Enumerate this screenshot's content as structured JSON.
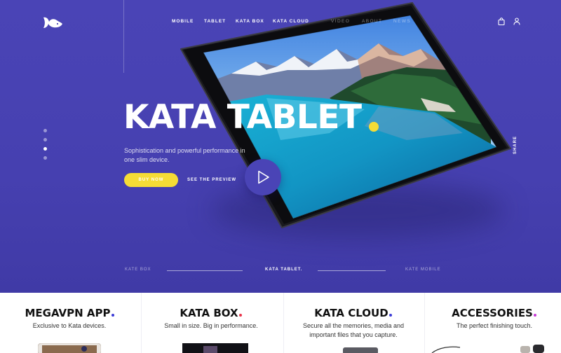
{
  "header": {
    "logo": "fish-logo",
    "nav": [
      {
        "label": "MOBILE",
        "dim": false
      },
      {
        "label": "TABLET",
        "dim": false
      },
      {
        "label": "KATA BOX",
        "dim": false
      },
      {
        "label": "KATA CLOUD",
        "dim": false
      },
      {
        "label": "VIDEO",
        "dim": true
      },
      {
        "label": "ABOUT",
        "dim": true
      },
      {
        "label": "NEWS",
        "dim": true
      }
    ],
    "icons": [
      "bag-icon",
      "user-icon"
    ]
  },
  "hero": {
    "title": "KATA TABLET",
    "subtitle": "Sophistication and powerful performance in one slim device.",
    "buy_label": "BUY NOW",
    "preview_label": "SEE THE PREVIEW",
    "share_label": "SHARE",
    "slide_dots": 4,
    "active_dot": 3,
    "accent_color": "#f5dc36",
    "background_color": "#4a44b6"
  },
  "slider_nav": {
    "prev": "KATE BOX",
    "current": "KATA TABLET.",
    "next": "KATE MOBILE"
  },
  "cards": [
    {
      "title": "MEGAVPN APP",
      "dot_color": "#3b3bd6",
      "desc": "Exclusive to Kata devices."
    },
    {
      "title": "KATA BOX",
      "dot_color": "#e8334a",
      "desc": "Small in size. Big in performance."
    },
    {
      "title": "KATA CLOUD",
      "dot_color": "#3b3bd6",
      "desc": "Secure all the memories, media and important files that you capture."
    },
    {
      "title": "ACCESSORIES",
      "dot_color": "#c63bd6",
      "desc": "The perfect finishing touch."
    }
  ]
}
